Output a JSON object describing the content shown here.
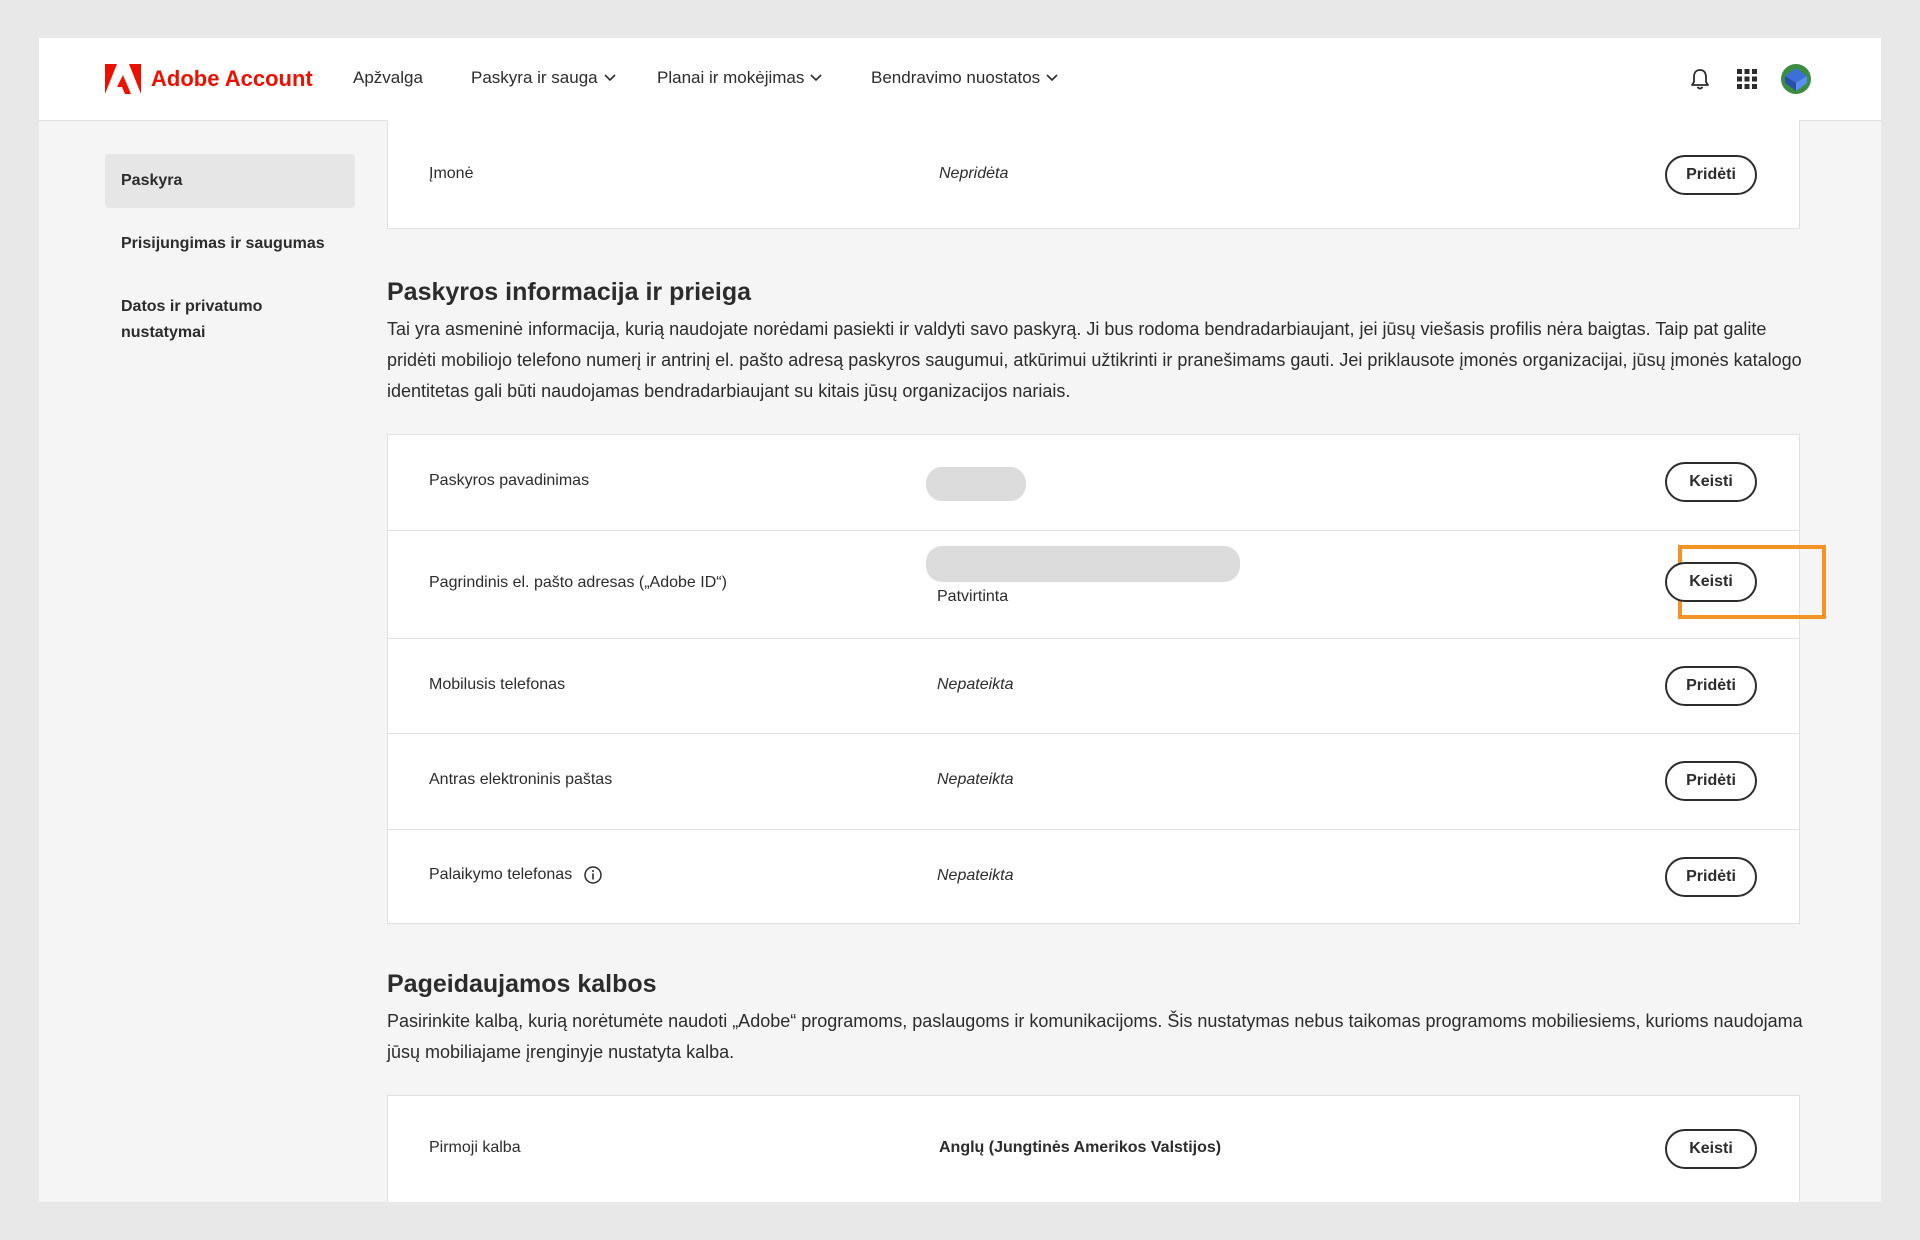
{
  "header": {
    "brand": "Adobe Account",
    "nav": [
      {
        "label": "Apžvalga",
        "has_dropdown": false
      },
      {
        "label": "Paskyra ir sauga",
        "has_dropdown": true
      },
      {
        "label": "Planai ir mokėjimas",
        "has_dropdown": true
      },
      {
        "label": "Bendravimo nuostatos",
        "has_dropdown": true
      }
    ],
    "icons": [
      "bell-icon",
      "apps-grid-icon",
      "avatar"
    ]
  },
  "sidebar": {
    "items": [
      {
        "label": "Paskyra",
        "active": true
      },
      {
        "label": "Prisijungimas ir saugumas",
        "active": false
      },
      {
        "label": "Datos ir privatumo nustatymai",
        "active": false
      }
    ]
  },
  "company_card": {
    "label": "Įmonė",
    "value": "Nepridėta",
    "button": "Pridėti"
  },
  "account_section": {
    "title": "Paskyros informacija ir prieiga",
    "description": "Tai yra asmeninė informacija, kurią naudojate norėdami pasiekti ir valdyti savo paskyrą. Ji bus rodoma bendradarbiaujant, jei jūsų viešasis profilis nėra baigtas. Taip pat galite pridėti mobiliojo telefono numerį ir antrinį el. pašto adresą paskyros saugumui, atkūrimui užtikrinti ir pranešimams gauti. Jei priklausote įmonės organizacijai, jūsų įmonės katalogo identitetas gali būti naudojamas bendradarbiaujant su kitais jūsų organizacijos nariais.",
    "rows": [
      {
        "label": "Paskyros pavadinimas",
        "value": "",
        "button": "Keisti"
      },
      {
        "label": "Pagrindinis el. pašto adresas („Adobe ID“)",
        "value": "",
        "status": "Patvirtinta",
        "button": "Keisti",
        "highlighted": true
      },
      {
        "label": "Mobilusis telefonas",
        "value": "Nepateikta",
        "button": "Pridėti"
      },
      {
        "label": "Antras elektroninis paštas",
        "value": "Nepateikta",
        "button": "Pridėti"
      },
      {
        "label": "Palaikymo telefonas",
        "value": "Nepateikta",
        "button": "Pridėti"
      }
    ]
  },
  "language_section": {
    "title": "Pageidaujamos kalbos",
    "description": "Pasirinkite kalbą, kurią norėtumėte naudoti „Adobe“ programoms, paslaugoms ir komunikacijoms. Šis nustatymas nebus taikomas programoms mobiliesiems, kurioms naudojama jūsų mobiliajame įrenginyje nustatyta kalba.",
    "rows": [
      {
        "label": "Pirmoji kalba",
        "value": "Anglų (Jungtinės Amerikos Valstijos)",
        "button": "Keisti"
      }
    ]
  },
  "colors": {
    "brand": "#eb1000",
    "highlight": "#f29423",
    "text": "#2c2c2c",
    "background": "#f5f5f5"
  }
}
